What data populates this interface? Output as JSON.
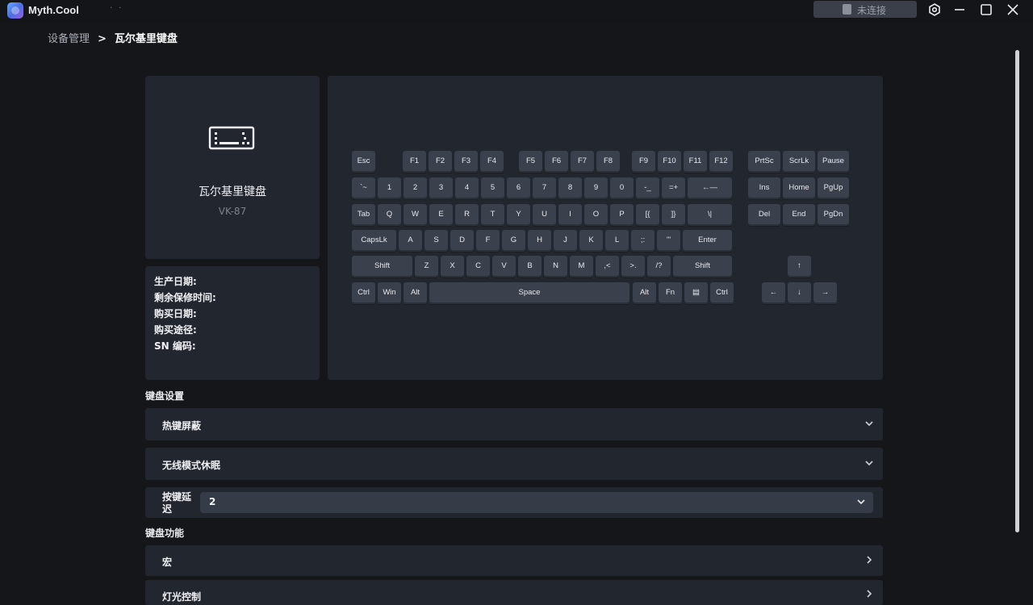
{
  "app": {
    "name": "Myth.Cool",
    "dots": "· ·"
  },
  "titlebar": {
    "connection_status": "未连接"
  },
  "breadcrumb": {
    "parent": "设备管理",
    "separator": ">",
    "current": "瓦尔基里键盘"
  },
  "device": {
    "name": "瓦尔基里键盘",
    "model": "VK-87"
  },
  "info": {
    "production_date": "生产日期:",
    "warranty_remaining": "剩余保修时间:",
    "purchase_date": "购买日期:",
    "purchase_channel": "购买途径:",
    "sn_code": "SN 编码:"
  },
  "keyboard": {
    "keys": [
      "Esc",
      "F1",
      "F2",
      "F3",
      "F4",
      "F5",
      "F6",
      "F7",
      "F8",
      "F9",
      "F10",
      "F11",
      "F12",
      "PrtSc",
      "ScrLk",
      "Pause",
      "`~",
      "1",
      "2",
      "3",
      "4",
      "5",
      "6",
      "7",
      "8",
      "9",
      "0",
      "-_",
      "=+",
      "←—",
      "Ins",
      "Home",
      "PgUp",
      "Tab",
      "Q",
      "W",
      "E",
      "R",
      "T",
      "Y",
      "U",
      "I",
      "O",
      "P",
      "[{",
      "]}",
      "\\|",
      "Del",
      "End",
      "PgDn",
      "CapsLk",
      "A",
      "S",
      "D",
      "F",
      "G",
      "H",
      "J",
      "K",
      "L",
      ";:",
      "'\"",
      "Enter",
      "Shift",
      "Z",
      "X",
      "C",
      "V",
      "B",
      "N",
      "M",
      ",<",
      ">.",
      "/?",
      "Shift",
      "↑",
      "Ctrl",
      "Win",
      "Alt",
      "Space",
      "Alt",
      "Fn",
      "▤",
      "Ctrl",
      "←",
      "↓",
      "→"
    ]
  },
  "settings": {
    "section_title": "键盘设置",
    "hotkey_block": "热键屏蔽",
    "wireless_sleep": "无线模式休眠",
    "key_delay_label": "按键延迟",
    "key_delay_value": "2"
  },
  "functions": {
    "section_title": "键盘功能",
    "macro": "宏",
    "lighting": "灯光控制"
  }
}
